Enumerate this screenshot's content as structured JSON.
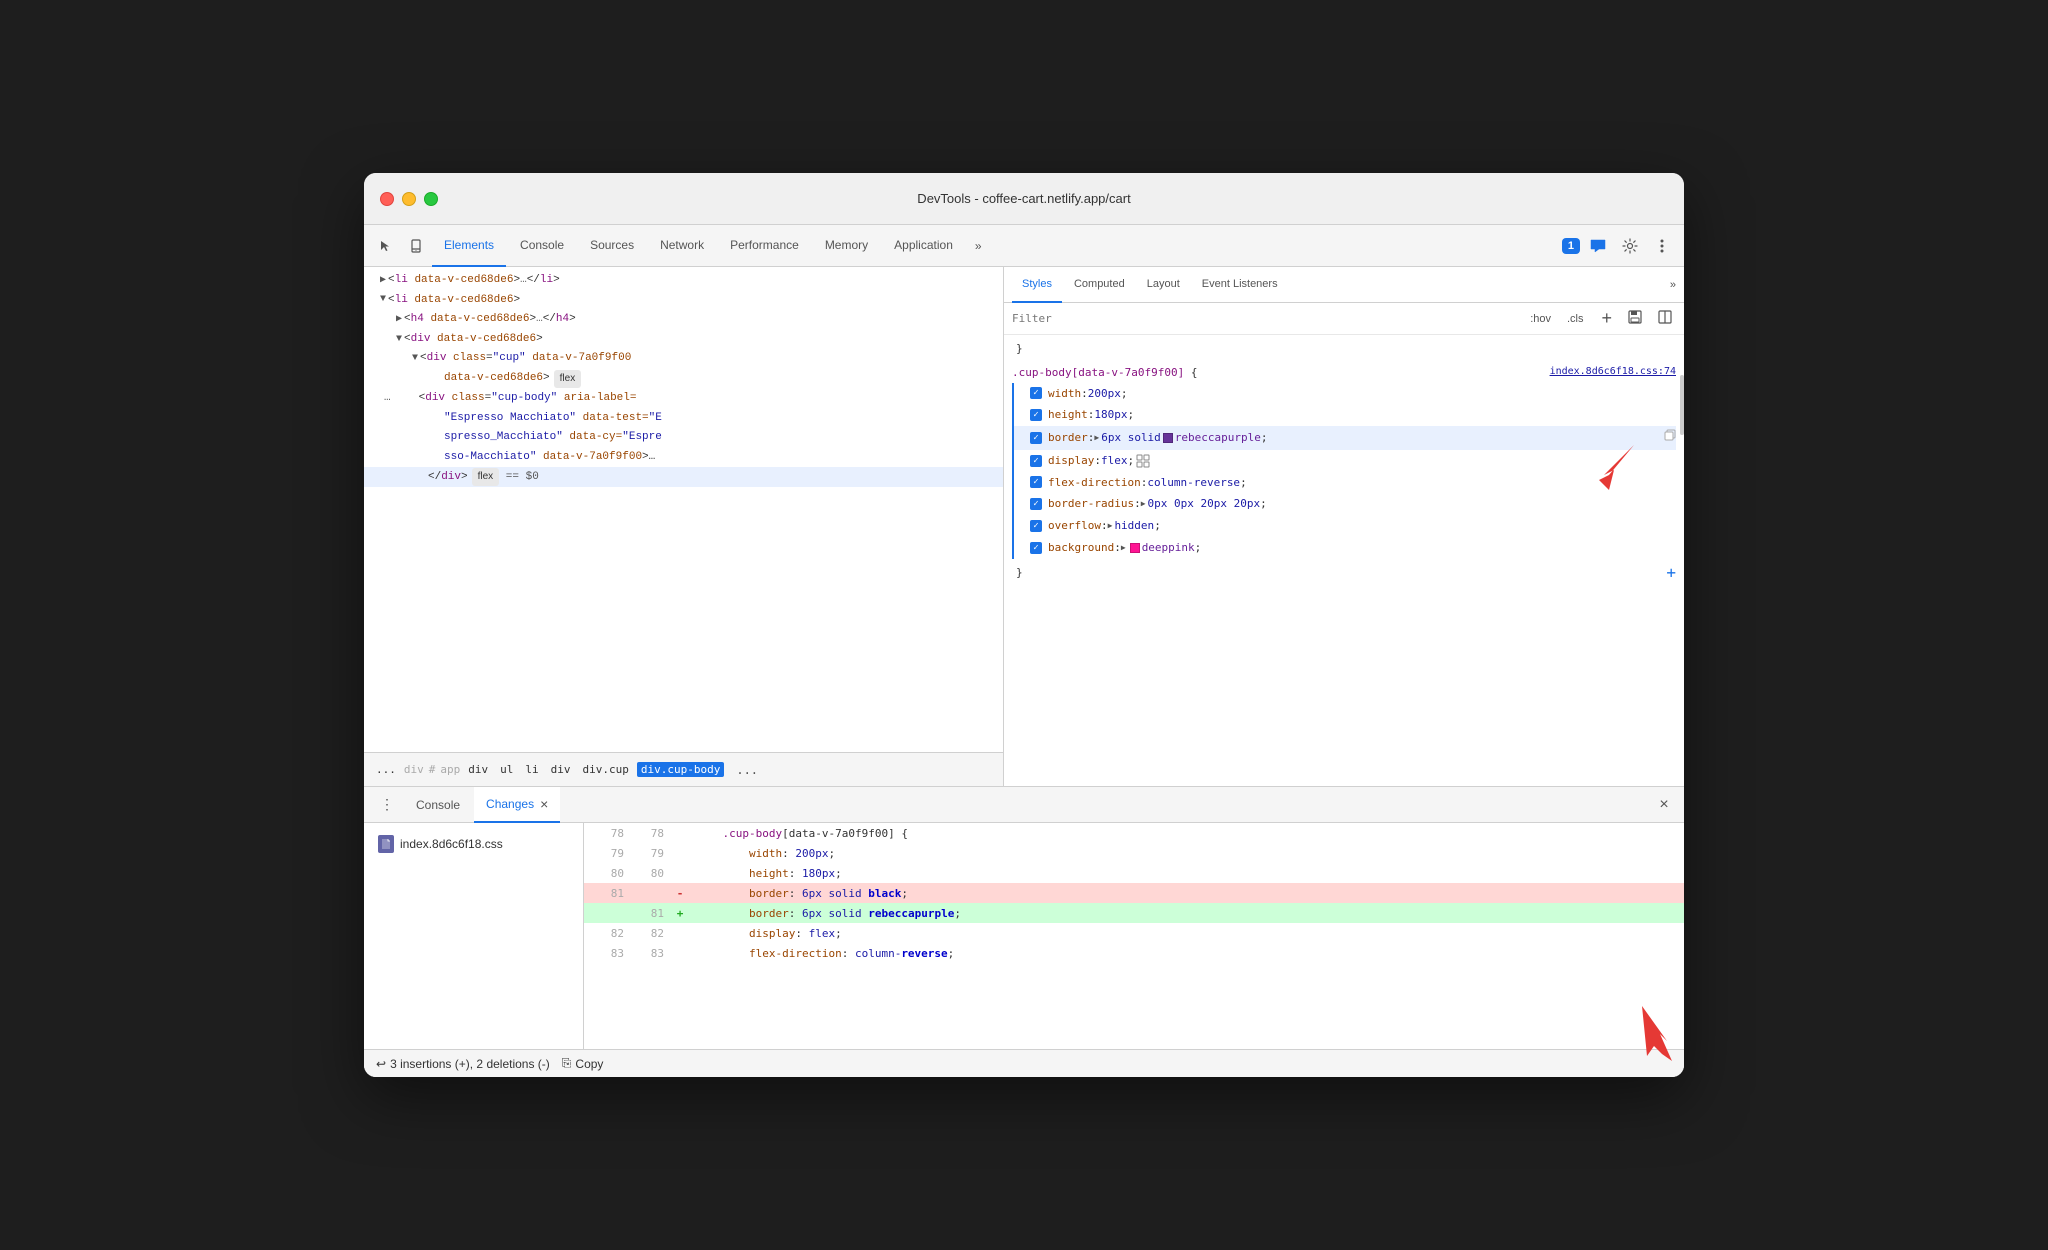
{
  "window": {
    "title": "DevTools - coffee-cart.netlify.app/cart"
  },
  "devtools_tabs": {
    "items": [
      "Elements",
      "Console",
      "Sources",
      "Network",
      "Performance",
      "Memory",
      "Application"
    ],
    "active": "Elements",
    "more_label": "»",
    "badge": "1"
  },
  "elements_panel": {
    "lines": [
      {
        "indent": 0,
        "content": "<li data-v-ced68de6>…</li>",
        "collapsed": true
      },
      {
        "indent": 0,
        "content": "<li data-v-ced68de6>",
        "collapsed": false
      },
      {
        "indent": 1,
        "content": "<h4 data-v-ced68de6>…</h4>",
        "collapsed": true
      },
      {
        "indent": 1,
        "content": "<div data-v-ced68de6>",
        "collapsed": false
      },
      {
        "indent": 2,
        "content_parts": [
          "<div class=\"cup\" data-v-7a0f9f00",
          "data-v-ced68de6>"
        ],
        "pill": "flex"
      },
      {
        "indent": 3,
        "content": "<div class=\"cup-body\" aria-label=",
        "continued": "\"Espresso Macchiato\" data-test=\"E",
        "continued2": "spresso_Macchiato\" data-cy=\"Espre",
        "continued3": "sso-Macchiato\" data-v-7a0f9f00>…"
      },
      {
        "indent": 3,
        "content": "</div>",
        "pill": "flex",
        "equals": "== $0"
      }
    ]
  },
  "breadcrumb": {
    "items": [
      "...",
      "div#app",
      "div",
      "ul",
      "li",
      "div",
      "div.cup",
      "div.cup-body"
    ],
    "active": "div.cup-body",
    "more": "..."
  },
  "styles_panel": {
    "tabs": [
      "Styles",
      "Computed",
      "Layout",
      "Event Listeners"
    ],
    "active_tab": "Styles",
    "more_label": "»",
    "filter_placeholder": "Filter",
    "pseudo_btns": [
      ":hov",
      ".cls"
    ],
    "rule": {
      "selector": ".cup-body[data-v-7a0f9f00] {",
      "source": "index.8d6c6f18.css:74",
      "properties": [
        {
          "name": "width",
          "value": "200px",
          "checked": true,
          "modified": true
        },
        {
          "name": "height",
          "value": "180px",
          "checked": true,
          "modified": true
        },
        {
          "name": "border",
          "value": "6px solid",
          "color": "#663399",
          "color_name": "rebeccapurple",
          "checked": true,
          "modified": true,
          "has_copy": true
        },
        {
          "name": "display",
          "value": "flex",
          "checked": true,
          "modified": true,
          "has_grid_icon": true
        },
        {
          "name": "flex-direction",
          "value": "column-reverse",
          "checked": true,
          "modified": true
        },
        {
          "name": "border-radius",
          "value": "0px 0px 20px 20px",
          "checked": true,
          "modified": true
        },
        {
          "name": "overflow",
          "value": "hidden",
          "checked": true,
          "modified": true
        },
        {
          "name": "background",
          "value": "deeppink",
          "color": "#ff1493",
          "checked": true,
          "modified": true
        }
      ]
    }
  },
  "bottom_panel": {
    "tabs": [
      "Console",
      "Changes"
    ],
    "active_tab": "Changes",
    "close_label": "×",
    "file": "index.8d6c6f18.css",
    "diff_lines": [
      {
        "num1": "78",
        "num2": "78",
        "type": "context",
        "text": "    .cup-body[data-v-7a0f9f00] {"
      },
      {
        "num1": "79",
        "num2": "79",
        "type": "context",
        "text": "        width: 200px;"
      },
      {
        "num1": "80",
        "num2": "80",
        "type": "context",
        "text": "        height: 180px;"
      },
      {
        "num1": "81",
        "num2": "",
        "type": "removed",
        "marker": "-",
        "text": "        border: 6px solid ",
        "changed_word": "black",
        "text_after": ";"
      },
      {
        "num1": "",
        "num2": "81",
        "type": "added",
        "marker": "+",
        "text": "        border: 6px solid ",
        "changed_word": "rebeccapurple",
        "text_after": ";"
      },
      {
        "num1": "82",
        "num2": "82",
        "type": "context",
        "text": "        display: flex;"
      },
      {
        "num1": "83",
        "num2": "83",
        "type": "context",
        "text": "        flex-direction: column-reverse;"
      }
    ],
    "footer": {
      "undo_label": "↩ 3 insertions (+), 2 deletions (-)",
      "copy_icon": "⎘",
      "copy_label": "Copy"
    }
  }
}
